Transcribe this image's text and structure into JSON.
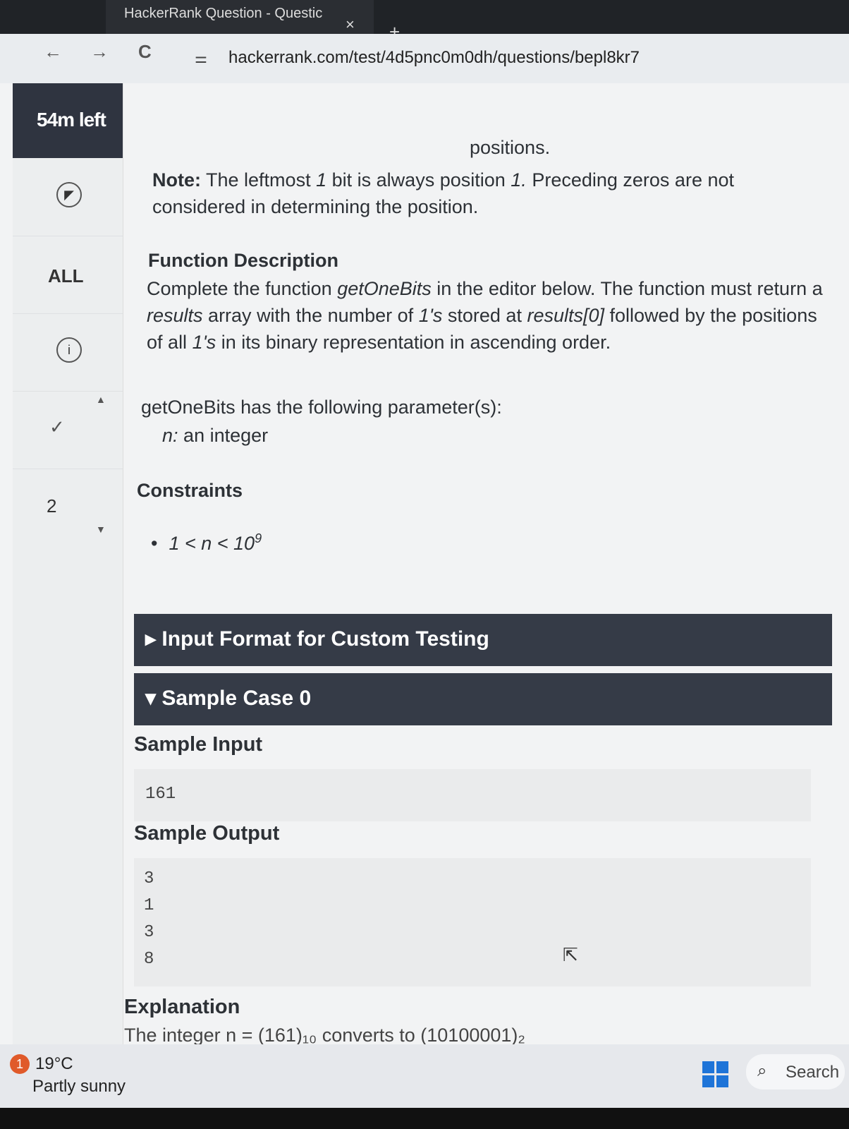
{
  "browser": {
    "tab_title": "HackerRank Question - Questic",
    "tab_close": "×",
    "new_tab": "+",
    "back": "←",
    "forward": "→",
    "reload": "C",
    "site_info_icon": "⚌",
    "url": "hackerrank.com/test/4d5pnc0m0dh/questions/bepl8kr7"
  },
  "sidebar": {
    "timer": "54m left",
    "all_label": "ALL",
    "info_icon": "i",
    "check_icon": "✓",
    "question_number": "2",
    "caret_up": "▲",
    "caret_down": "▼"
  },
  "question": {
    "positions_tail": "positions.",
    "note_label": "Note:",
    "note_a": "The leftmost",
    "note_one": "1",
    "note_b": "bit is always position",
    "note_pos": "1.",
    "note_c": "Preceding zeros are not considered in",
    "note_d": "determining the position.",
    "func_heading": "Function Description",
    "func_a": "Complete the function",
    "func_name": "getOneBits",
    "func_b": "in the editor below. The function must return a",
    "func_results": "results",
    "func_c": "array with the number of",
    "func_ones": "1's",
    "func_d": "stored at",
    "func_r0": "results[0]",
    "func_e": "followed by the positions of",
    "func_f": "all",
    "func_g": "1's",
    "func_h": "in its binary representation in ascending order.",
    "params_line": "getOneBits has the following parameter(s):",
    "param_name": "n:",
    "param_desc": "an integer",
    "constraints_heading": "Constraints",
    "constraint_bullet": "•",
    "constraint_text": "1 < n < 10",
    "constraint_exp": "9",
    "input_format_bar": "▸ Input Format for Custom Testing",
    "sample_case_bar": "▾ Sample Case 0",
    "sample_input_heading": "Sample Input",
    "sample_input_value": "161",
    "sample_output_heading": "Sample Output",
    "sample_output_lines": [
      "3",
      "1",
      "3",
      "8"
    ],
    "explanation_heading": "Explanation",
    "explanation_text": "The integer n = (161)₁₀ converts to (10100001)₂"
  },
  "taskbar": {
    "weather_badge": "1",
    "temperature": "19°C",
    "condition": "Partly sunny",
    "search_icon": "⌕",
    "search_label": "Search",
    "cursor_icon": "⇱"
  },
  "colors": {
    "dark_bar": "#353b47",
    "timer_bg": "#2f3440",
    "page_bg": "#f2f3f4",
    "windows_blue": "#1e74d8"
  }
}
